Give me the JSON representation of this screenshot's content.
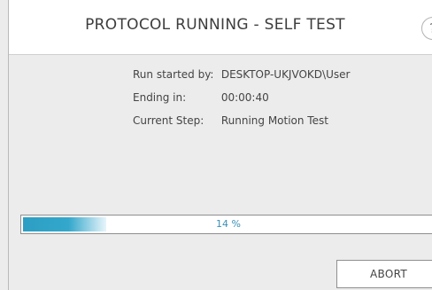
{
  "header": {
    "title": "PROTOCOL RUNNING - SELF TEST",
    "help_label": "?"
  },
  "run_info": [
    {
      "label": "Run started by:",
      "value": "DESKTOP-UKJVOKD\\User"
    },
    {
      "label": "Ending in:",
      "value": "00:00:40"
    },
    {
      "label": "Current Step:",
      "value": "Running Motion Test"
    }
  ],
  "progress": {
    "percent": 14,
    "text": "14 %",
    "color": "#2c9ec3"
  },
  "actions": {
    "abort_label": "ABORT"
  }
}
